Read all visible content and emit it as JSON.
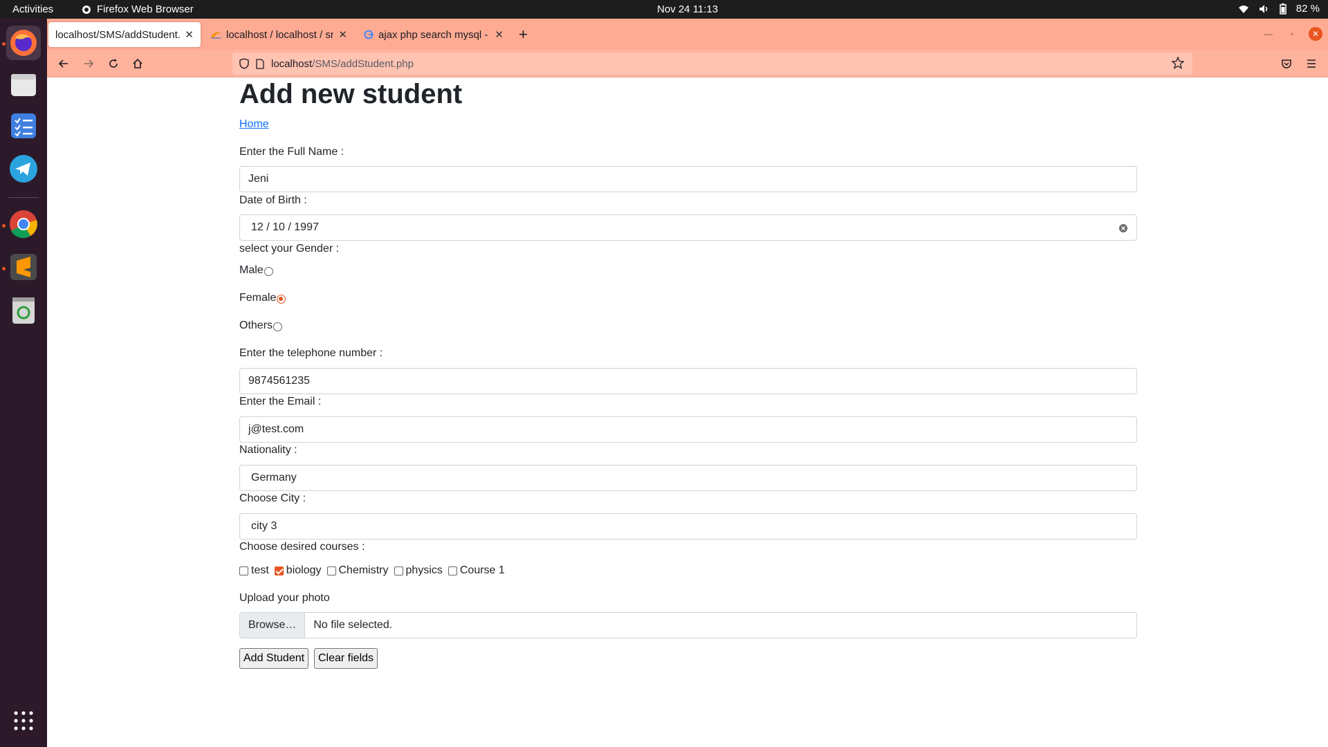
{
  "topbar": {
    "activities": "Activities",
    "app_name": "Firefox Web Browser",
    "clock": "Nov 24  11:13",
    "battery": "82 %"
  },
  "dock": {
    "items": [
      "firefox-icon",
      "files-icon",
      "tasks-icon",
      "telegram-icon",
      "chrome-icon",
      "sublime-text-icon",
      "trash-icon",
      "app-grid-icon"
    ]
  },
  "browser": {
    "tabs": [
      {
        "title": "localhost/SMS/addStudent.p",
        "active": true
      },
      {
        "title": "localhost / localhost / sm",
        "active": false
      },
      {
        "title": "ajax php search mysql - G",
        "active": false
      }
    ],
    "url_host": "localhost",
    "url_path": "/SMS/addStudent.php"
  },
  "page": {
    "title": "Add new student",
    "home_link": "Home",
    "full_name_label": "Enter the Full Name :",
    "full_name_value": "Jeni",
    "dob_label": "Date of Birth :",
    "dob_value": "12 / 10 / 1997",
    "gender_label": "select your Gender :",
    "gender_options": [
      "Male",
      "Female",
      "Others"
    ],
    "gender_selected": "Female",
    "phone_label": "Enter the telephone number :",
    "phone_value": "9874561235",
    "email_label": "Enter the Email :",
    "email_value": "j@test.com",
    "nationality_label": "Nationality :",
    "nationality_value": "Germany",
    "city_label": "Choose City :",
    "city_value": "city 3",
    "courses_label": "Choose desired courses :",
    "courses": [
      {
        "name": "test",
        "checked": false
      },
      {
        "name": "biology",
        "checked": true
      },
      {
        "name": "Chemistry",
        "checked": false
      },
      {
        "name": "physics",
        "checked": false
      },
      {
        "name": "Course 1",
        "checked": false
      }
    ],
    "photo_label": "Upload your photo",
    "browse_button": "Browse…",
    "file_status": "No file selected.",
    "add_button": "Add Student",
    "clear_button": "Clear fields"
  },
  "colors": {
    "tab_bar": "#ffab94",
    "accent": "#e95420",
    "link": "#0d6efd"
  }
}
